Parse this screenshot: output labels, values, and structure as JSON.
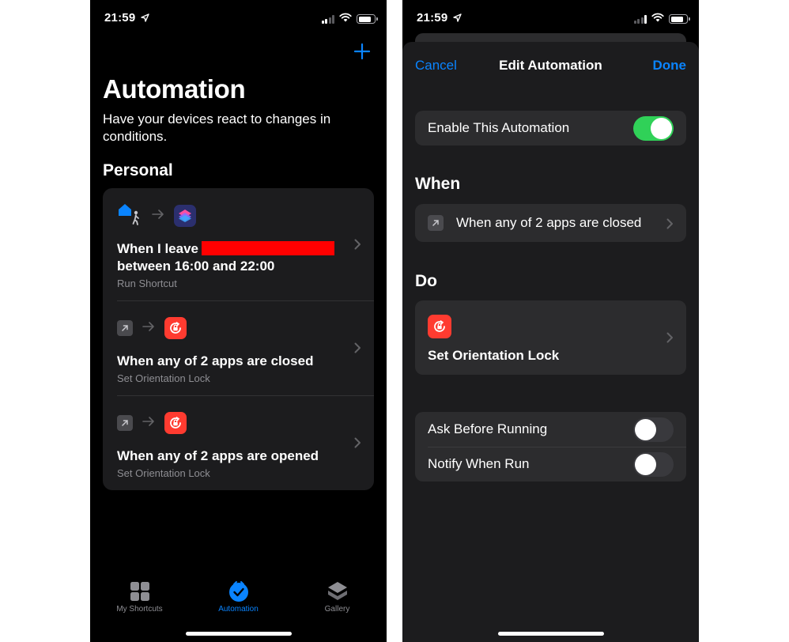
{
  "left": {
    "status": {
      "time": "21:59"
    },
    "title": "Automation",
    "subtitle": "Have your devices react to changes in conditions.",
    "section": "Personal",
    "automations": [
      {
        "title_prefix": "When I leave",
        "title_line2": "between 16:00 and 22:00",
        "subtitle": "Run Shortcut",
        "trigger_icon": "home-leave-icon",
        "action_icon": "shortcuts-icon"
      },
      {
        "title": "When any of 2 apps are closed",
        "subtitle": "Set Orientation Lock",
        "trigger_icon": "app-arrow-icon",
        "action_icon": "orientation-lock-icon"
      },
      {
        "title": "When any of 2 apps are opened",
        "subtitle": "Set Orientation Lock",
        "trigger_icon": "app-arrow-icon",
        "action_icon": "orientation-lock-icon"
      }
    ],
    "tabs": [
      {
        "label": "My Shortcuts",
        "icon": "grid-icon",
        "active": false
      },
      {
        "label": "Automation",
        "icon": "clock-check-icon",
        "active": true
      },
      {
        "label": "Gallery",
        "icon": "layers-icon",
        "active": false
      }
    ]
  },
  "right": {
    "status": {
      "time": "21:59"
    },
    "nav": {
      "cancel": "Cancel",
      "title": "Edit Automation",
      "done": "Done"
    },
    "enable": {
      "label": "Enable This Automation",
      "on": true
    },
    "when": {
      "heading": "When",
      "label": "When any of 2 apps are closed"
    },
    "do": {
      "heading": "Do",
      "label": "Set Orientation Lock"
    },
    "options": [
      {
        "label": "Ask Before Running",
        "on": false
      },
      {
        "label": "Notify When Run",
        "on": false
      }
    ]
  },
  "colors": {
    "accent": "#0a84ff",
    "toggle_on": "#30d158",
    "action_red": "#ff3b30",
    "card_bg": "#1c1c1e",
    "redaction": "#ff0000"
  }
}
